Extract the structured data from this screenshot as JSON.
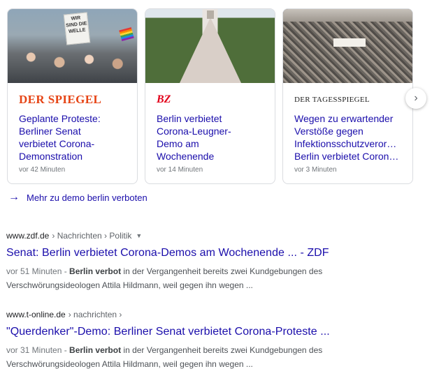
{
  "top_stories": [
    {
      "source": "DER SPIEGEL",
      "headline_lines": [
        "Geplante Proteste:",
        "Berliner Senat",
        "verbietet Corona-",
        "Demonstration"
      ],
      "time": "vor 42 Minuten",
      "image_sign_text": "WIR SIND DIE WELLE"
    },
    {
      "source": "BZ",
      "headline_lines": [
        "Berlin verbietet",
        "Corona-Leugner-",
        "Demo am",
        "Wochenende"
      ],
      "time": "vor 14 Minuten"
    },
    {
      "source": "DER TAGESSPIEGEL",
      "headline_lines": [
        "Wegen zu erwartender",
        "Verstöße gegen",
        "Infektionsschutzverordnung:",
        "Berlin verbietet Corona-Demos"
      ],
      "time": "vor 3 Minuten"
    }
  ],
  "more_link": "Mehr zu demo berlin verboten",
  "results": [
    {
      "domain": "www.zdf.de",
      "path": "› Nachrichten › Politik",
      "title": "Senat: Berlin verbietet Corona-Demos am Wochenende ... - ZDF",
      "date": "vor 51 Minuten - ",
      "bold": "Berlin verbot",
      "snippet_1": " in der Vergangenheit bereits zwei Kundgebungen des",
      "snippet_2": "Verschwörungsideologen Attila Hildmann, weil gegen ihn wegen ..."
    },
    {
      "domain": "www.t-online.de",
      "path": "› nachrichten ›",
      "title": "\"Querdenker\"-Demo: Berliner Senat verbietet Corona-Proteste ...",
      "date": "vor 31 Minuten - ",
      "bold": "Berlin verbot",
      "snippet_1": " in der Vergangenheit bereits zwei Kundgebungen des",
      "snippet_2": "Verschwörungsideologen Attila Hildmann, weil gegen ihn wegen ..."
    }
  ],
  "icons": {
    "next": "chevron-right-icon",
    "more": "arrow-right-icon",
    "dropdown": "caret-down-icon"
  },
  "colors": {
    "link": "#1a0dab",
    "spiegel": "#e64415",
    "bz": "#e2001a"
  }
}
